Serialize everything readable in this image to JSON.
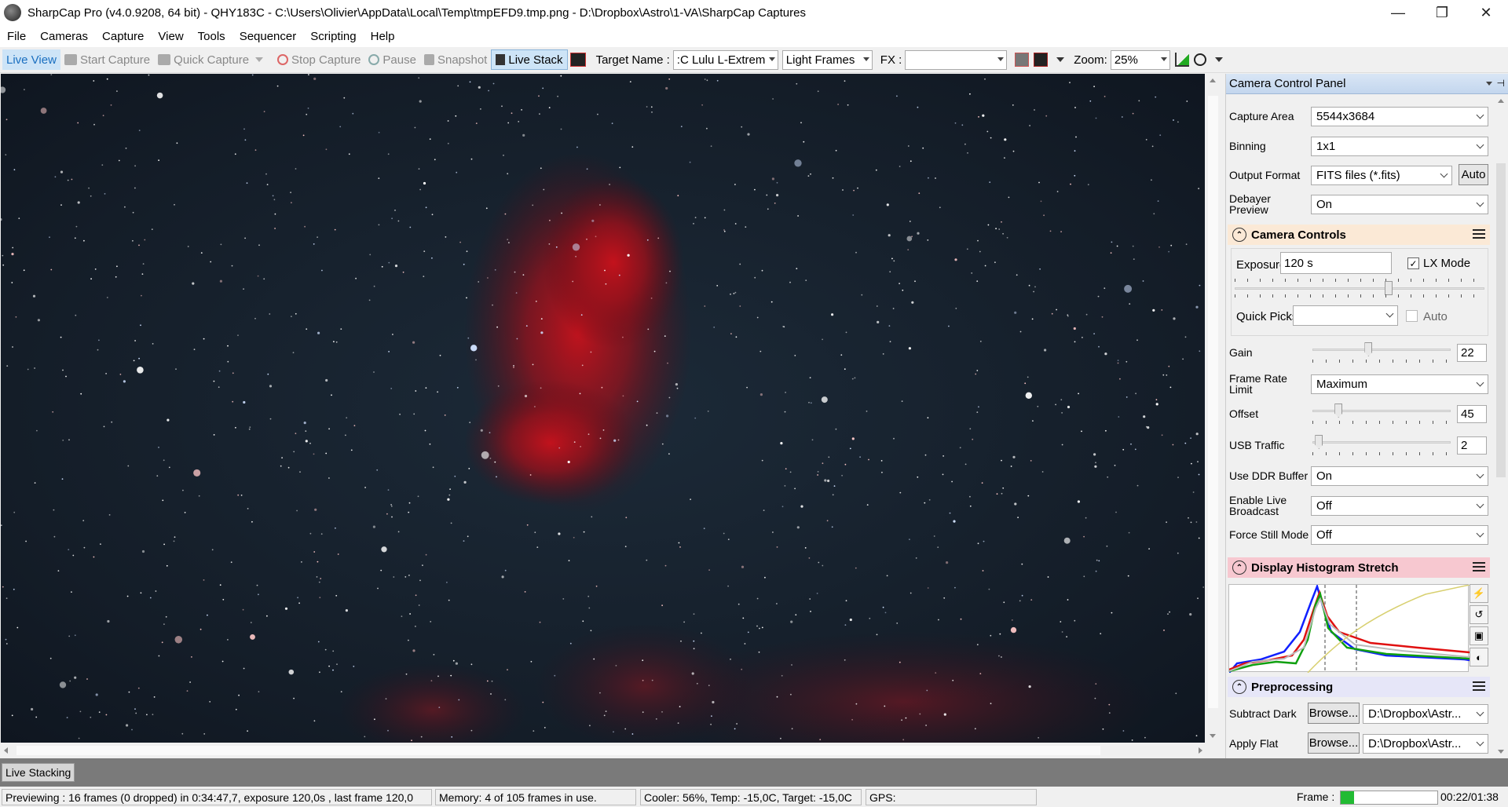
{
  "window": {
    "title": "SharpCap Pro (v4.0.9208, 64 bit) - QHY183C - C:\\Users\\Olivier\\AppData\\Local\\Temp\\tmpEFD9.tmp.png - D:\\Dropbox\\Astro\\1-VA\\SharpCap Captures",
    "minimize": "—",
    "restore": "❐",
    "close": "✕"
  },
  "menu": [
    "File",
    "Cameras",
    "Capture",
    "View",
    "Tools",
    "Sequencer",
    "Scripting",
    "Help"
  ],
  "toolbar": {
    "live_view": "Live View",
    "start_capture": "Start Capture",
    "quick_capture": "Quick Capture",
    "stop_capture": "Stop Capture",
    "pause": "Pause",
    "snapshot": "Snapshot",
    "live_stack": "Live Stack",
    "target_name_label": "Target Name :",
    "target_name_value": ":C Lulu L-Extrem",
    "frame_type": "Light Frames",
    "fx_label": "FX :",
    "fx_value": "",
    "zoom_label": "Zoom:",
    "zoom_value": "25%"
  },
  "panel": {
    "title": "Camera Control Panel",
    "capture_area_label": "Capture Area",
    "capture_area_value": "5544x3684",
    "binning_label": "Binning",
    "binning_value": "1x1",
    "output_format_label": "Output Format",
    "output_format_value": "FITS files (*.fits)",
    "auto_button": "Auto",
    "debayer_label": "Debayer Preview",
    "debayer_value": "On",
    "camera_controls": {
      "title": "Camera Controls",
      "exposure_label": "Exposure",
      "exposure_value": "120 s",
      "lx_mode_label": "LX Mode",
      "lx_mode_checked": true,
      "exposure_slider_fraction": 0.62,
      "quick_picks_label": "Quick Picks",
      "quick_picks_value": "",
      "auto_label": "Auto",
      "auto_checked": false
    },
    "gain_label": "Gain",
    "gain_value": "22",
    "gain_fraction": 0.4,
    "frame_rate_label": "Frame Rate Limit",
    "frame_rate_value": "Maximum",
    "offset_label": "Offset",
    "offset_value": "45",
    "offset_fraction": 0.17,
    "usb_label": "USB Traffic",
    "usb_value": "2",
    "usb_fraction": 0.02,
    "ddr_label": "Use DDR Buffer",
    "ddr_value": "On",
    "broadcast_label": "Enable Live Broadcast",
    "broadcast_value": "Off",
    "still_label": "Force Still Mode",
    "still_value": "Off",
    "histogram": {
      "title": "Display Histogram Stretch",
      "head_color": "#f7c8d0"
    },
    "preprocessing": {
      "title": "Preprocessing",
      "subtract_dark_label": "Subtract Dark",
      "flat_label": "Apply Flat",
      "browse": "Browse...",
      "dark_path": "D:\\Dropbox\\Astr...",
      "flat_path": "D:\\Dropbox\\Astr..."
    }
  },
  "stack_tab": "Live Stacking",
  "status": {
    "preview": "Previewing : 16 frames (0 dropped) in 0:34:47,7, exposure 120,0s , last frame 120,0",
    "memory": "Memory: 4 of 105 frames in use.",
    "cooler": "Cooler: 56%, Temp: -15,0C, Target: -15,0C",
    "gps": "GPS:",
    "frame_label": "Frame :",
    "frame_fraction": 0.14,
    "timer": "00:22/01:38"
  },
  "colors": {
    "accent": "#1a6fc0",
    "camera_controls_head": "#fbe9d6",
    "preprocessing_head": "#e6e6f8",
    "panel_header": "#c8daf0",
    "nebula": "#c0101a"
  },
  "icons": {
    "app": "sharpcap-logo-icon",
    "camera": "camera-icon",
    "stop": "stop-circle-icon",
    "pause": "pause-circle-icon",
    "snapshot": "snapshot-icon",
    "stack": "stack-icon",
    "hamburger": "menu-icon",
    "collapse": "collapse-icon"
  }
}
